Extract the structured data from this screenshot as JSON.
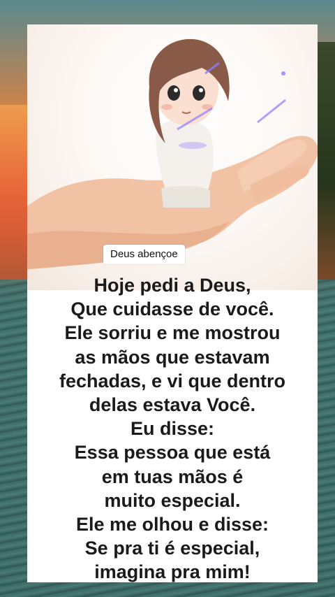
{
  "badge": {
    "label": "Deus abençoe"
  },
  "poem": {
    "lines": [
      "Hoje pedi a Deus,",
      "Que cuidasse de você.",
      "Ele sorriu e me mostrou",
      "as mãos que estavam",
      "fechadas, e vi que dentro",
      "delas estava Você.",
      "Eu disse:",
      "Essa pessoa que está",
      "em tuas mãos é",
      "muito especial.",
      "Ele me olhou e disse:",
      "Se pra ti é especial,",
      "imagina pra mim!"
    ]
  },
  "colors": {
    "card": "#ffffff",
    "text": "#1a1a1a",
    "sky_orange": "#e8813a",
    "sea": "#3c6b68"
  }
}
